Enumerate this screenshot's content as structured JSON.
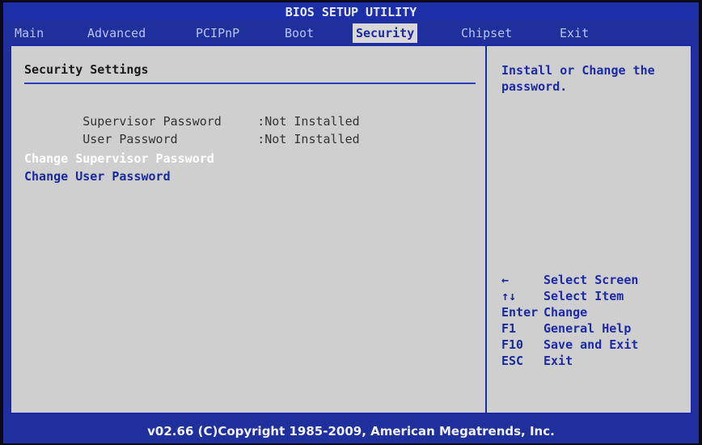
{
  "header": {
    "title": "BIOS SETUP UTILITY"
  },
  "tabs": [
    {
      "label": "Main"
    },
    {
      "label": "Advanced"
    },
    {
      "label": "PCIPnP"
    },
    {
      "label": "Boot"
    },
    {
      "label": "Security"
    },
    {
      "label": "Chipset"
    },
    {
      "label": "Exit"
    }
  ],
  "security": {
    "title": "Security Settings",
    "fields": [
      {
        "label": "Supervisor Password",
        "value": ":Not Installed"
      },
      {
        "label": "User Password",
        "value": ":Not Installed"
      }
    ],
    "menu": [
      {
        "label": "Change Supervisor Password"
      },
      {
        "label": "Change User Password"
      }
    ]
  },
  "help": {
    "text": "Install or Change the password.",
    "keys": [
      {
        "key": "←",
        "desc": "Select Screen"
      },
      {
        "key": "↑↓",
        "desc": "Select Item"
      },
      {
        "key": "Enter",
        "desc": "Change"
      },
      {
        "key": "F1",
        "desc": "General Help"
      },
      {
        "key": "F10",
        "desc": "Save and Exit"
      },
      {
        "key": "ESC",
        "desc": "Exit"
      }
    ]
  },
  "footer": {
    "text": "v02.66 (C)Copyright 1985-2009, American Megatrends, Inc."
  },
  "colors": {
    "background": "#1f2f9c",
    "panel": "#cfcfcf",
    "accent": "#1c2aa8",
    "selected_text": "#ffffff"
  }
}
